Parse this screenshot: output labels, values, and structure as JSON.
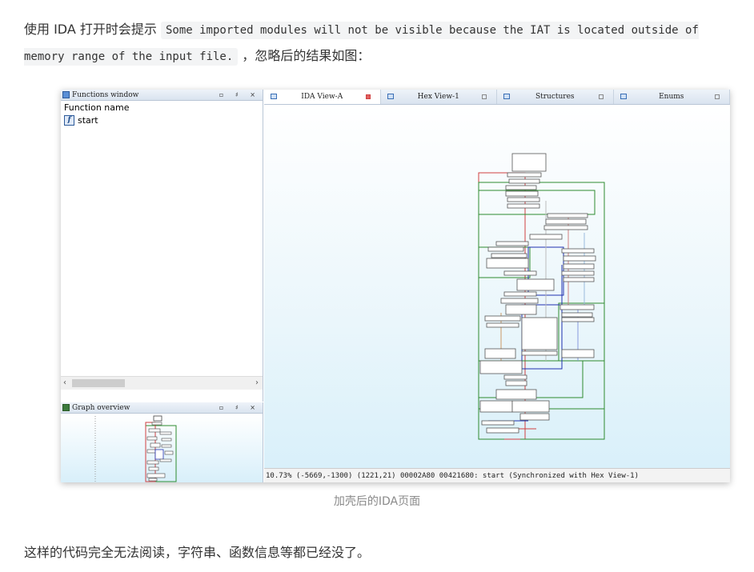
{
  "article": {
    "intro_prefix": "使用 IDA 打开时会提示",
    "intro_code": "Some imported modules will not be visible because the IAT is located outside of memory range of the input file.",
    "intro_suffix": "，忽略后的结果如图：",
    "caption": "加壳后的IDA页面",
    "conclusion": "这样的代码完全无法阅读，字符串、函数信息等都已经没了。"
  },
  "functions_window": {
    "title": "Functions window",
    "column_header": "Function name",
    "icon": "function-icon",
    "items": [
      {
        "icon_glyph": "f",
        "name": "start"
      }
    ]
  },
  "graph_overview": {
    "title": "Graph overview"
  },
  "tabs": [
    {
      "label": "IDA View-A",
      "active": true
    },
    {
      "label": "Hex View-1",
      "active": false
    },
    {
      "label": "Structures",
      "active": false
    },
    {
      "label": "Enums",
      "active": false
    }
  ],
  "status_bar": {
    "text": "10.73% (-5669,-1300) (1221,21) 00002A80 00421680: start (Synchronized with Hex View-1)"
  },
  "colors": {
    "edge_red": "#d04040",
    "edge_green": "#2e8b2e",
    "edge_blue": "#2030b0",
    "node_fill": "#ffffff",
    "canvas_bottom": "#d9f0fa"
  }
}
